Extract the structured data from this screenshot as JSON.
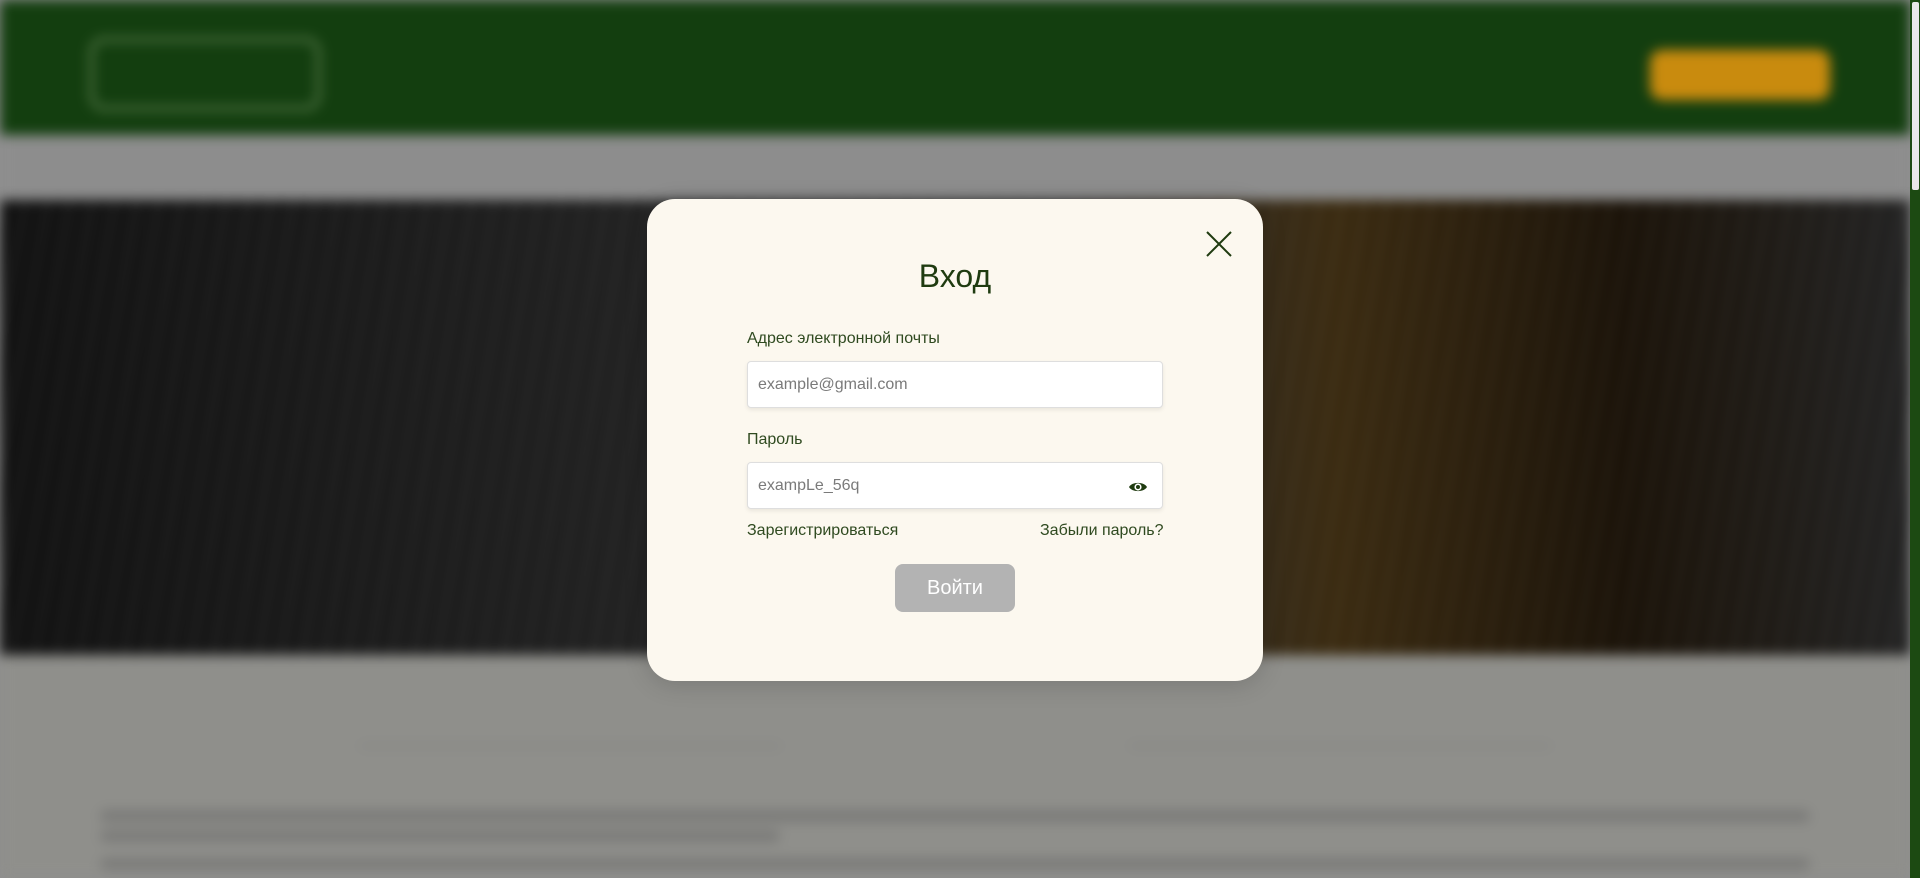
{
  "background": {
    "header_colors": {
      "bg": "#133e0f",
      "cta": "#c98b0e"
    }
  },
  "modal": {
    "title": "Вход",
    "close_icon": "close-icon",
    "email": {
      "label": "Адрес электронной почты",
      "placeholder": "example@gmail.com",
      "value": ""
    },
    "password": {
      "label": "Пароль",
      "placeholder": "exampLe_56q",
      "value": "",
      "toggle_icon": "eye-icon"
    },
    "register_link": "Зарегистрироваться",
    "forgot_link": "Забыли пароль?",
    "submit_label": "Войти",
    "colors": {
      "background": "#fcf8ef",
      "text": "#1f3b10",
      "button_disabled": "#b3b3b3"
    }
  }
}
